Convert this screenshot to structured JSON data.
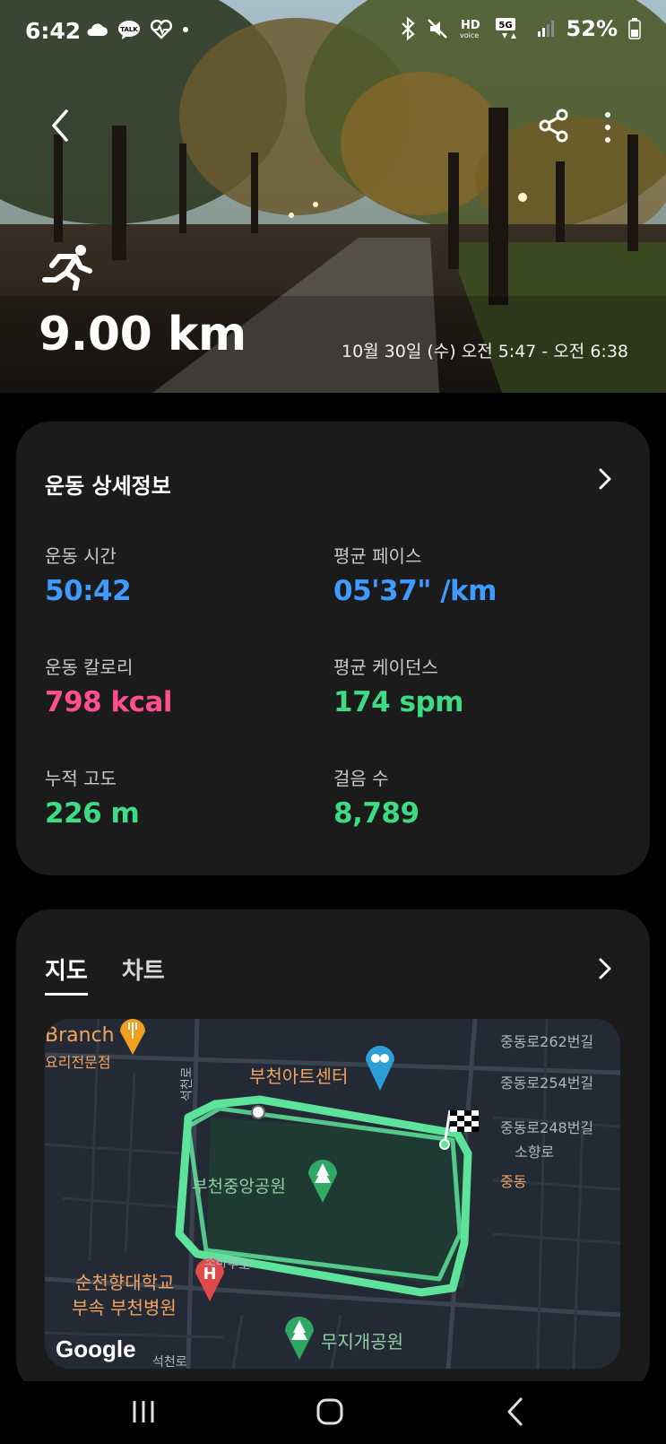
{
  "status_bar": {
    "time": "6:42",
    "battery": "52%",
    "icons": [
      "cloud-icon",
      "talk-icon",
      "health-icon",
      "dot-icon",
      "bluetooth-icon",
      "mute-icon",
      "hd-voice-icon",
      "5g-icon",
      "signal-icon",
      "battery-icon"
    ]
  },
  "hero": {
    "distance": "9.00 km",
    "date_range": "10월 30일 (수) 오전 5:47 - 오전 6:38",
    "icons": [
      "back-icon",
      "share-icon",
      "more-icon",
      "running-icon"
    ]
  },
  "details": {
    "title": "운동 상세정보",
    "stats": [
      {
        "label": "운동 시간",
        "value": "50:42",
        "color": "#3f9bff"
      },
      {
        "label": "평균 페이스",
        "value": "05'37\" /km",
        "color": "#3f9bff"
      },
      {
        "label": "운동 칼로리",
        "value": "798 kcal",
        "color": "#ff4f8e"
      },
      {
        "label": "평균 케이던스",
        "value": "174 spm",
        "color": "#3ddc84"
      },
      {
        "label": "누적 고도",
        "value": "226 m",
        "color": "#3ddc84"
      },
      {
        "label": "걸음 수",
        "value": "8,789",
        "color": "#3ddc84"
      }
    ]
  },
  "map_card": {
    "tabs": [
      {
        "label": "지도",
        "active": true
      },
      {
        "label": "차트",
        "active": false
      }
    ],
    "map_labels": {
      "branch": "Branch",
      "specialty": "요리전문점",
      "art_center": "부천아트센터",
      "road_262": "중동로262번길",
      "road_254": "중동로254번길",
      "road_248": "중동로248번길",
      "sohyang": "소향로",
      "jungdong": "중동",
      "seokcheon": "석천로",
      "park": "부천중앙공원",
      "jomaru": "조마루로",
      "hospital_1": "순천향대학교",
      "hospital_2": "부속 부천병원",
      "rainbow_park": "무지개공원",
      "road_bottom": "석천로",
      "google": "Google"
    },
    "route_color": "#5ee39a"
  },
  "nav_bar": {
    "icons": [
      "recent-apps-icon",
      "home-icon",
      "back-nav-icon"
    ]
  }
}
